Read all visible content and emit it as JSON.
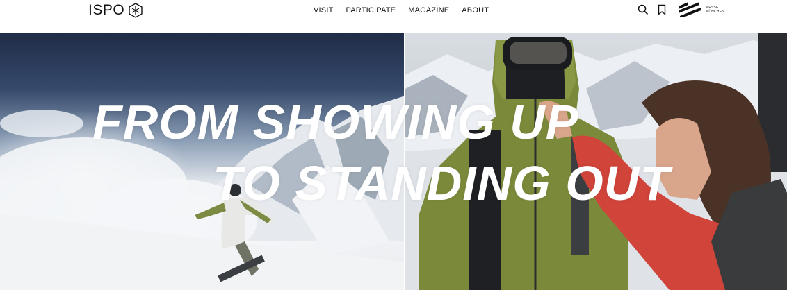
{
  "header": {
    "logo_text": "ISPO",
    "nav": [
      "VISIT",
      "PARTICIPATE",
      "MAGAZINE",
      "ABOUT"
    ],
    "icons": {
      "search": "search-icon",
      "bookmark": "bookmark-icon"
    },
    "partner_logo_text": [
      "MESSE",
      "MÜNCHEN"
    ]
  },
  "hero": {
    "headline_line1": "FROM SHOWING UP",
    "headline_line2": "TO STANDING OUT"
  },
  "colors": {
    "text": "#111111",
    "headline": "#ffffff",
    "jacket": "#7d8a3c",
    "sweater": "#d8483c",
    "sky": "#2a3a5a"
  }
}
